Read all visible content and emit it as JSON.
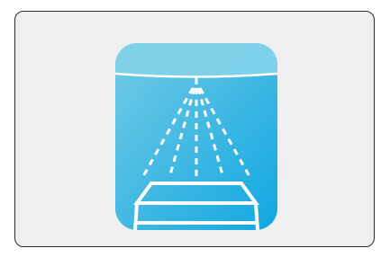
{
  "illustration": {
    "name": "shower-sprinkler-icon",
    "colors": {
      "card_background": "#efefef",
      "card_border": "#2b2b2b",
      "tile_gradient_start": "#73cbe5",
      "tile_gradient_end": "#11a7e1",
      "line_color": "#ffffff"
    }
  }
}
